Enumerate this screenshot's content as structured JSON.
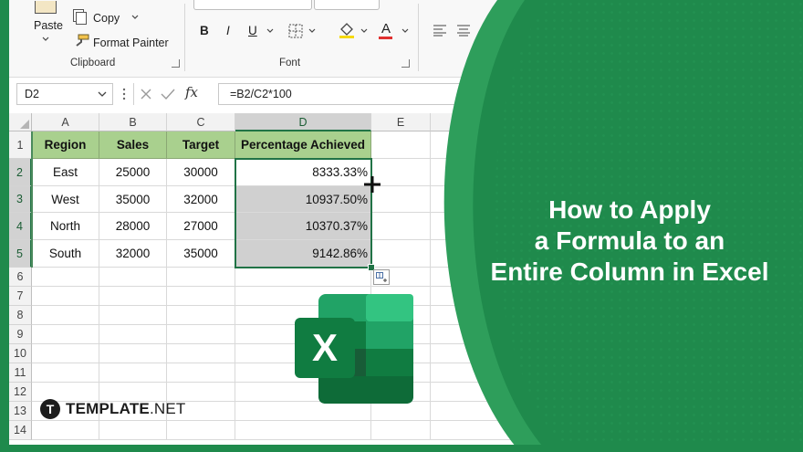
{
  "ribbon": {
    "clipboard": {
      "paste_label": "Paste",
      "copy_label": "Copy",
      "format_painter_label": "Format Painter",
      "group_label": "Clipboard"
    },
    "font": {
      "bold": "B",
      "italic": "I",
      "underline": "U",
      "font_color_glyph": "A",
      "group_label": "Font",
      "font_color": "#e0302f",
      "fill_color": "#f5d90f"
    }
  },
  "formula_bar": {
    "name_box": "D2",
    "fx": "fx",
    "formula": "=B2/C2*100"
  },
  "grid": {
    "columns": [
      "A",
      "B",
      "C",
      "D",
      "E"
    ],
    "selected_column": "D",
    "rows": [
      "1",
      "2",
      "3",
      "4",
      "5",
      "6",
      "7",
      "8",
      "9",
      "10",
      "11",
      "12",
      "13",
      "14"
    ],
    "header_fill": "#a9d08e",
    "table_headers": [
      "Region",
      "Sales",
      "Target",
      "Percentage Achieved"
    ],
    "table_rows": [
      [
        "East",
        "25000",
        "30000",
        "8333.33%"
      ],
      [
        "West",
        "35000",
        "32000",
        "10937.50%"
      ],
      [
        "North",
        "28000",
        "27000",
        "10370.37%"
      ],
      [
        "South",
        "32000",
        "35000",
        "9142.86%"
      ]
    ]
  },
  "overlay": {
    "title_line1": "How to Apply",
    "title_line2": "a Formula to an",
    "title_line3": "Entire Column in Excel",
    "logo_letter": "X",
    "brand_mark": "T",
    "brand_bold": "TEMPLATE",
    "brand_light": ".NET",
    "accent_color": "#1f8a4c"
  }
}
